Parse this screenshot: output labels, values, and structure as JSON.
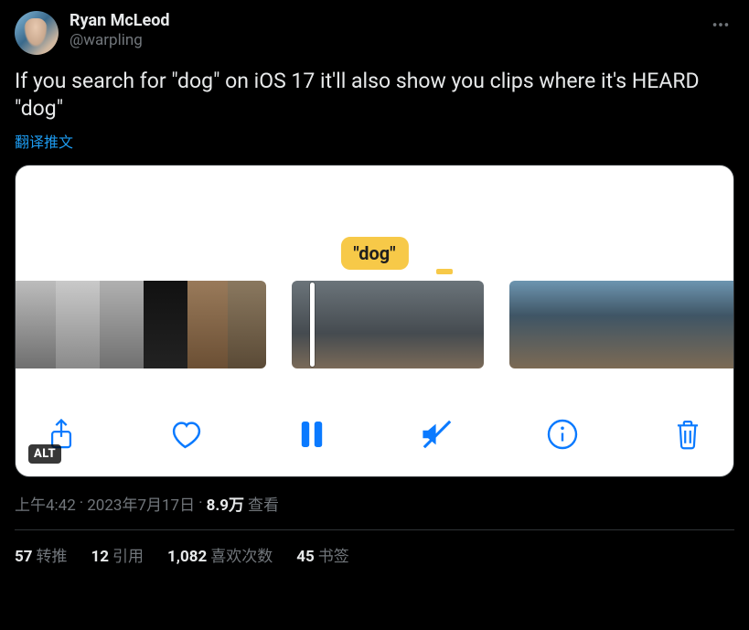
{
  "author": {
    "display_name": "Ryan McLeod",
    "handle": "@warpling"
  },
  "tweet_text": "If you search for \"dog\" on iOS 17 it'll also show you clips where it's HEARD \"dog\"",
  "translate_label": "翻译推文",
  "media": {
    "pill_text": "\"dog\"",
    "alt_badge": "ALT",
    "toolbar_icons": {
      "share": "share-icon",
      "like": "heart-icon",
      "pause": "pause-icon",
      "mute": "mute-icon",
      "info": "info-icon",
      "trash": "trash-icon"
    }
  },
  "meta": {
    "time": "上午4:42",
    "dot1": " · ",
    "date": "2023年7月17日",
    "dot2": " · ",
    "views_count": "8.9万",
    "views_label": " 查看"
  },
  "stats": {
    "retweets": {
      "count": "57",
      "label": "转推"
    },
    "quotes": {
      "count": "12",
      "label": "引用"
    },
    "likes": {
      "count": "1,082",
      "label": "喜欢次数"
    },
    "bookmarks": {
      "count": "45",
      "label": "书签"
    }
  }
}
